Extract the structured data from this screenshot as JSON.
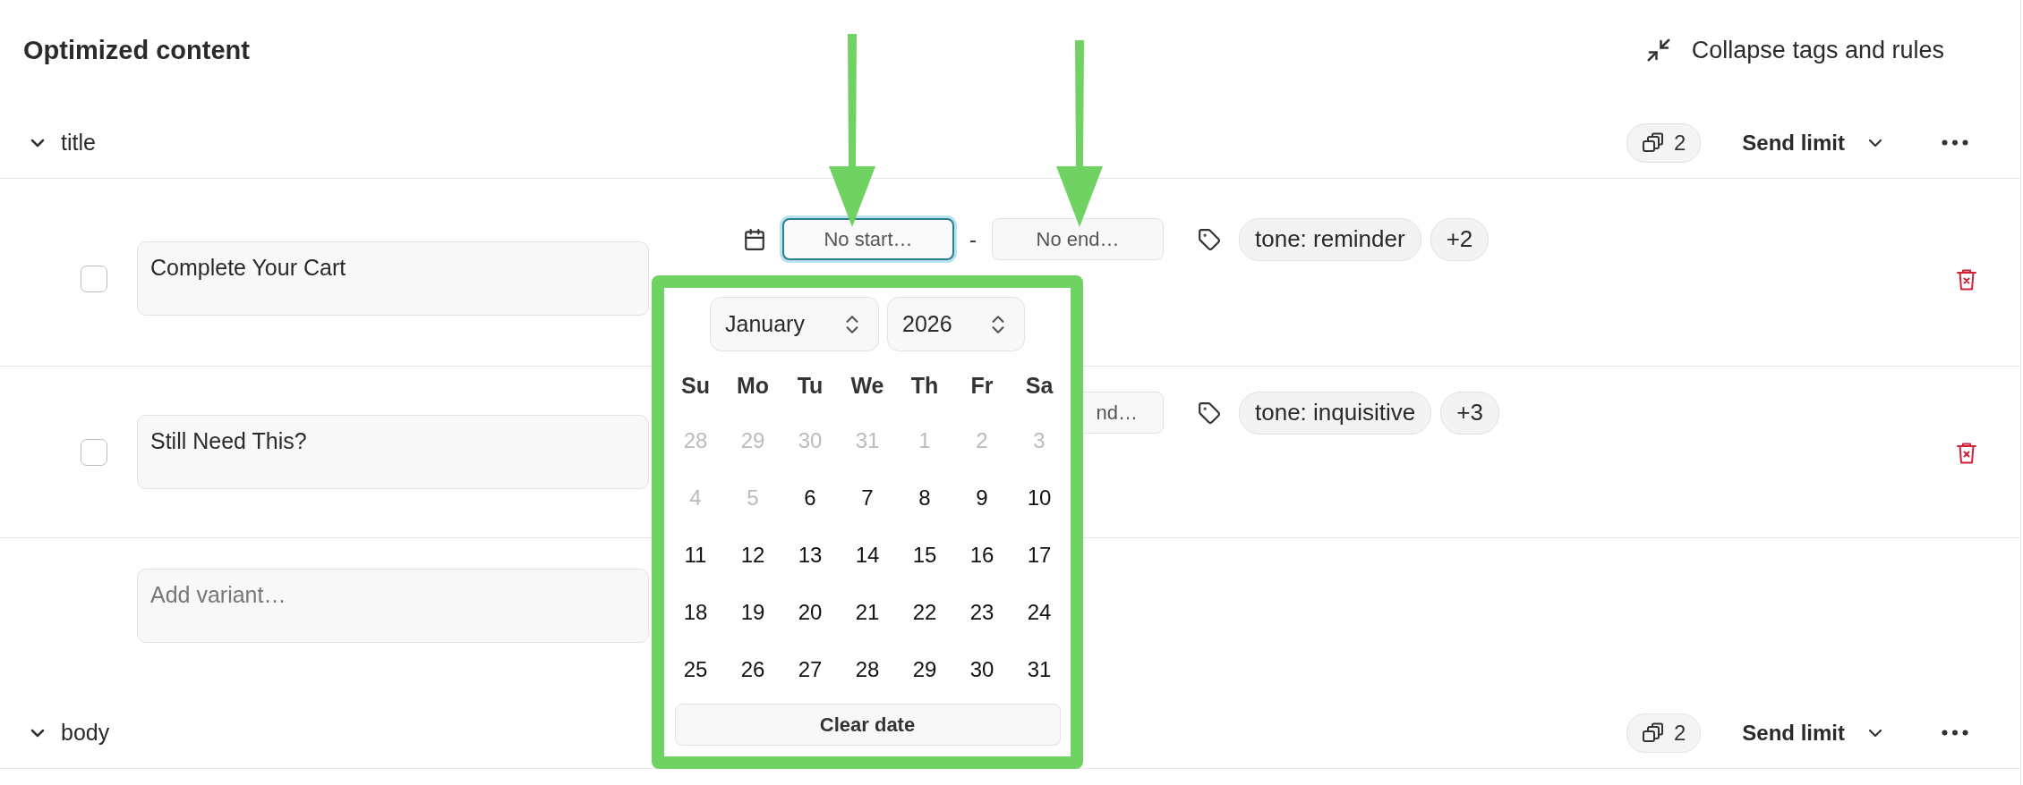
{
  "header": {
    "title": "Optimized content",
    "collapse_label": "Collapse tags and rules"
  },
  "sections": [
    {
      "name": "title",
      "expanded": true,
      "variant_count": "2",
      "send_limit": "Send limit",
      "variants": [
        {
          "text": "Complete Your Cart",
          "checked": false,
          "start": {
            "placeholder": "No start…",
            "focused": true
          },
          "separator": "-",
          "end": {
            "placeholder": "No end…",
            "focused": false
          },
          "tags": [
            "tone: reminder",
            "+2"
          ]
        },
        {
          "text": "Still Need This?",
          "checked": false,
          "end": {
            "placeholder": "nd…",
            "focused": false
          },
          "tags": [
            "tone: inquisitive",
            "+3"
          ]
        }
      ],
      "add_placeholder": "Add variant…"
    },
    {
      "name": "body",
      "expanded": true,
      "variant_count": "2",
      "send_limit": "Send limit"
    }
  ],
  "date_picker": {
    "month": "January",
    "year": "2026",
    "weekdays": [
      "Su",
      "Mo",
      "Tu",
      "We",
      "Th",
      "Fr",
      "Sa"
    ],
    "days": [
      {
        "label": "28",
        "outside": true
      },
      {
        "label": "29",
        "outside": true
      },
      {
        "label": "30",
        "outside": true
      },
      {
        "label": "31",
        "outside": true
      },
      {
        "label": "1",
        "outside": true
      },
      {
        "label": "2",
        "outside": true
      },
      {
        "label": "3",
        "outside": true
      },
      {
        "label": "4",
        "outside": true
      },
      {
        "label": "5",
        "outside": true
      },
      {
        "label": "6",
        "outside": false
      },
      {
        "label": "7",
        "outside": false
      },
      {
        "label": "8",
        "outside": false
      },
      {
        "label": "9",
        "outside": false
      },
      {
        "label": "10",
        "outside": false
      },
      {
        "label": "11",
        "outside": false
      },
      {
        "label": "12",
        "outside": false
      },
      {
        "label": "13",
        "outside": false
      },
      {
        "label": "14",
        "outside": false
      },
      {
        "label": "15",
        "outside": false
      },
      {
        "label": "16",
        "outside": false
      },
      {
        "label": "17",
        "outside": false
      },
      {
        "label": "18",
        "outside": false
      },
      {
        "label": "19",
        "outside": false
      },
      {
        "label": "20",
        "outside": false
      },
      {
        "label": "21",
        "outside": false
      },
      {
        "label": "22",
        "outside": false
      },
      {
        "label": "23",
        "outside": false
      },
      {
        "label": "24",
        "outside": false
      },
      {
        "label": "25",
        "outside": false
      },
      {
        "label": "26",
        "outside": false
      },
      {
        "label": "27",
        "outside": false
      },
      {
        "label": "28",
        "outside": false
      },
      {
        "label": "29",
        "outside": false
      },
      {
        "label": "30",
        "outside": false
      },
      {
        "label": "31",
        "outside": false
      }
    ],
    "clear_label": "Clear date"
  }
}
